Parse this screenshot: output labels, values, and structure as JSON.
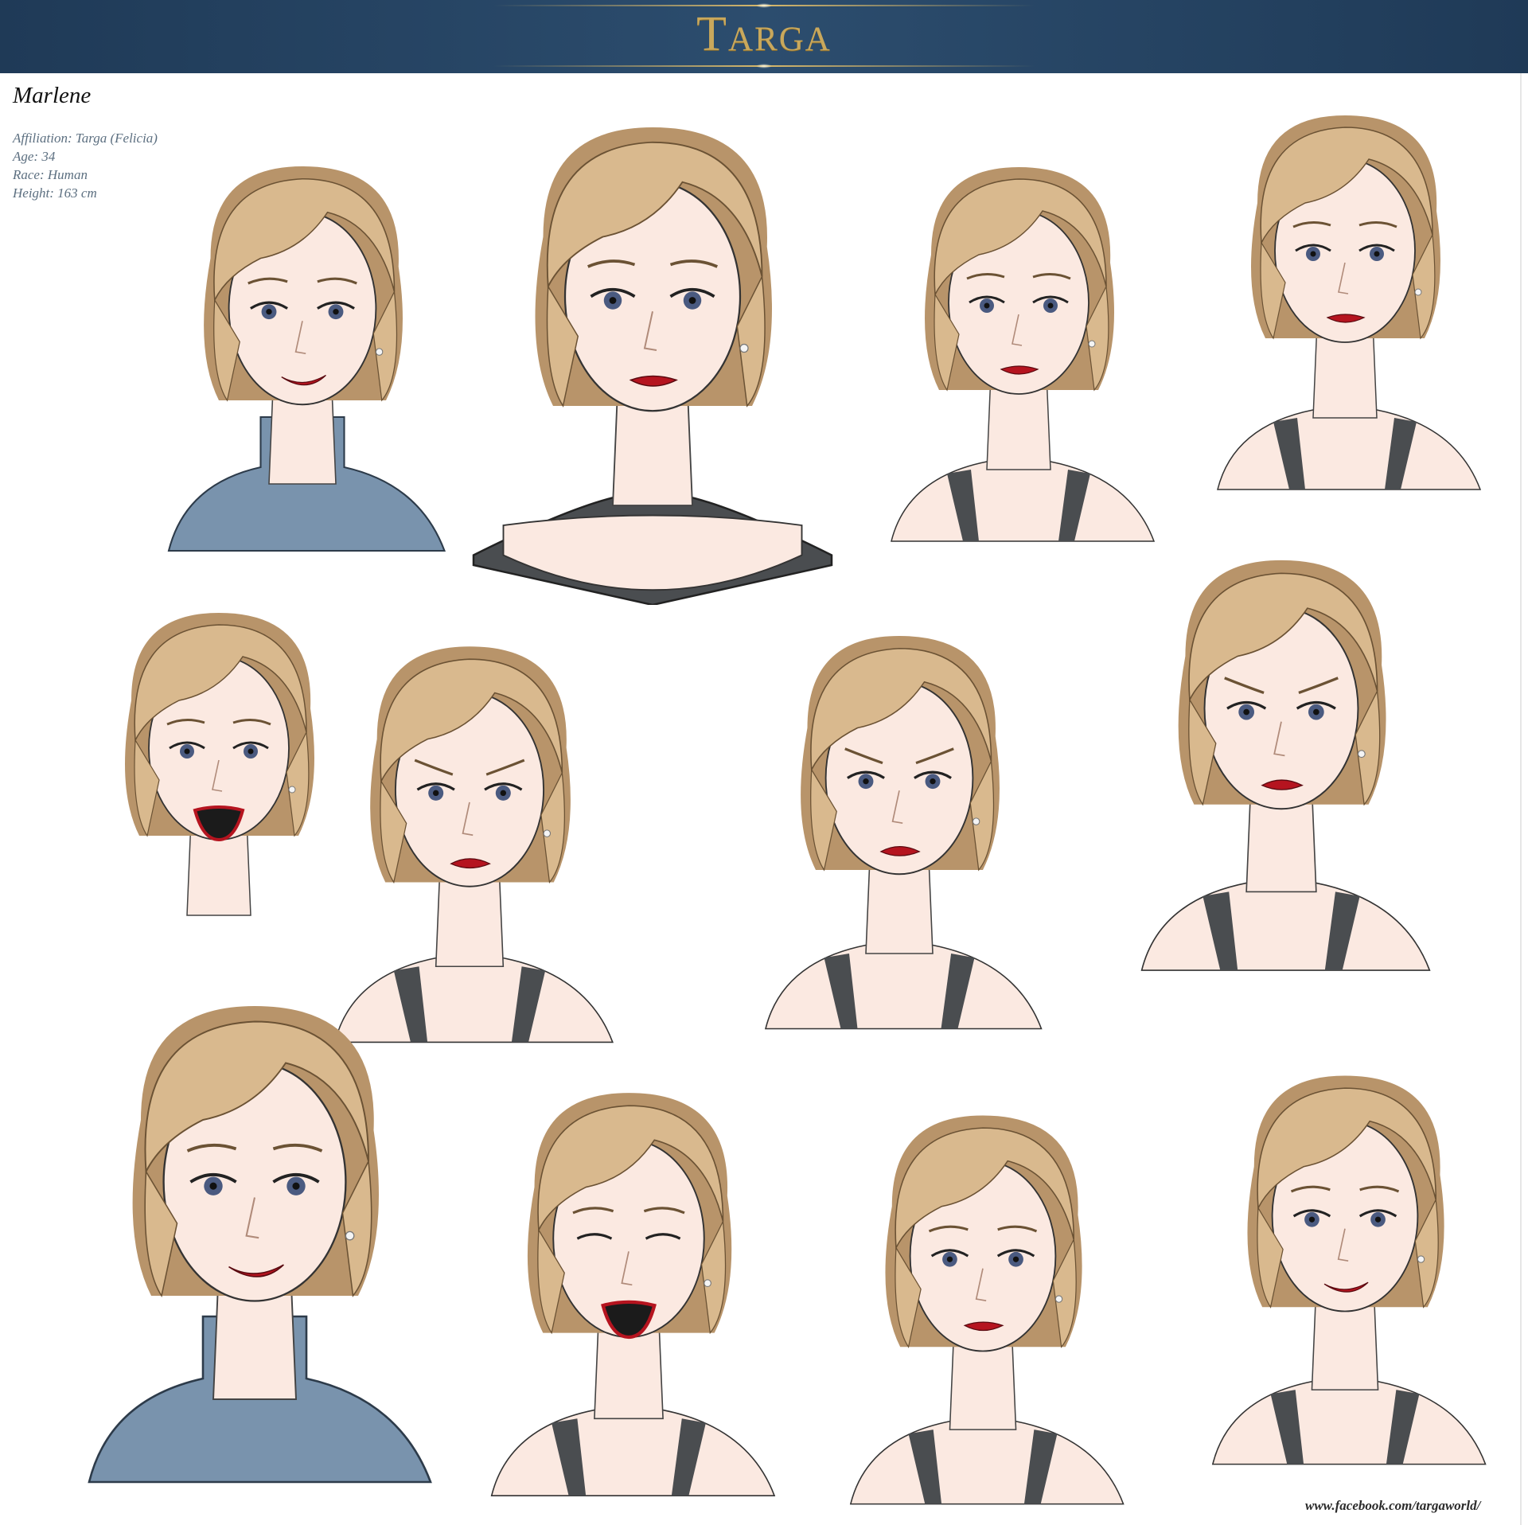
{
  "banner": {
    "title": "Targa"
  },
  "character": {
    "name": "Marlene",
    "details": [
      "Affiliation: Targa (Felicia)",
      "Age:  34",
      "Race:  Human",
      "Height: 163 cm"
    ]
  },
  "footer": {
    "url": "www.facebook.com/targaworld/"
  },
  "palette": {
    "hair": "#d9b98e",
    "hair_shadow": "#b8946a",
    "skin": "#fbe9e1",
    "lips": "#b5141f",
    "eyes": "#4a5a80",
    "sweater": "#7993ad",
    "top_dark": "#4a4d50",
    "banner": "#2c4d6e",
    "banner_gold": "#c9a85c"
  },
  "portraits": [
    {
      "expression": "smile",
      "clothing": "sweater"
    },
    {
      "expression": "neutral-front",
      "clothing": "dark-top"
    },
    {
      "expression": "profile-right-tilt",
      "clothing": "tank"
    },
    {
      "expression": "profile-right",
      "clothing": "tank"
    },
    {
      "expression": "profile-left-shout",
      "clothing": "none"
    },
    {
      "expression": "frown",
      "clothing": "tank"
    },
    {
      "expression": "annoyed",
      "clothing": "tank"
    },
    {
      "expression": "angry",
      "clothing": "tank"
    },
    {
      "expression": "smile-hand",
      "clothing": "sweater"
    },
    {
      "expression": "laugh-wink",
      "clothing": "tank"
    },
    {
      "expression": "hand-on-cheek",
      "clothing": "tank"
    },
    {
      "expression": "smirk",
      "clothing": "tank"
    }
  ]
}
